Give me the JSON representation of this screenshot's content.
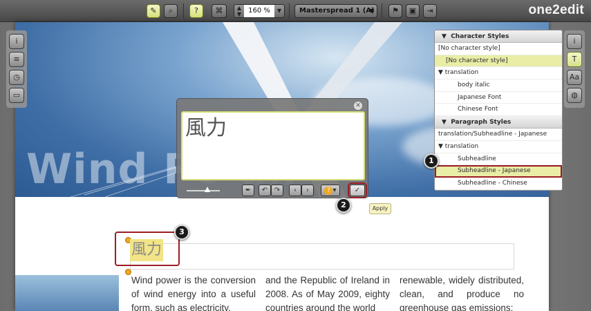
{
  "app": {
    "logo": "one2edit"
  },
  "toolbar": {
    "zoom": "160 %",
    "spread": "Masterspread 1 (A)"
  },
  "page": {
    "hero_headline": "Wind Po        an",
    "subheadline_cjk": "風力",
    "columns": [
      "Wind power is the conversion of wind energy into a useful form, such as electricity,",
      "and the Republic of Ireland in 2008. As of May 2009, eighty countries around the world",
      "renewable, widely distributed, clean, and produce no greenhouse gas emissions;"
    ]
  },
  "styles_panel": {
    "character_header": "Character Styles",
    "char_current": "[No character style]",
    "char_items": {
      "none": "[No character style]",
      "group": "translation",
      "body_italic": "body italic",
      "japanese_font": "Japanese Font",
      "chinese_font": "Chinese Font"
    },
    "paragraph_header": "Paragraph Styles",
    "para_current": "translation/Subheadline - Japanese",
    "para_items": {
      "group": "translation",
      "subheadline": "Subheadline",
      "subheadline_japanese": "Subheadline - Japanese",
      "subheadline_chinese": "Subheadline - Chinese"
    }
  },
  "editor": {
    "text": "風力",
    "apply_tooltip": "Apply"
  },
  "callouts": [
    "1",
    "2",
    "3"
  ],
  "colors": {
    "accent_highlight": "#e9eda6",
    "callout_border": "#9b1c23",
    "marker": "#f2a81d"
  }
}
